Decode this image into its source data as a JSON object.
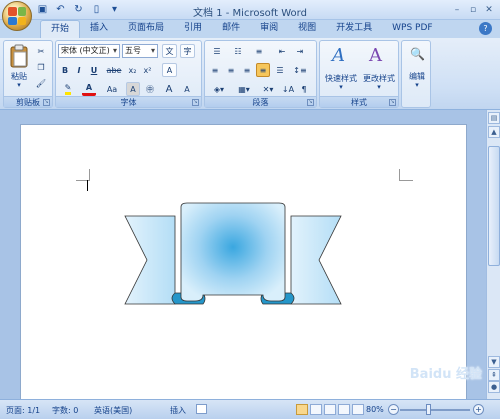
{
  "window": {
    "title": "文档 1 - Microsoft Word"
  },
  "tabs": [
    "开始",
    "插入",
    "页面布局",
    "引用",
    "邮件",
    "审阅",
    "视图",
    "开发工具",
    "WPS PDF"
  ],
  "active_tab": "开始",
  "ribbon": {
    "clipboard": {
      "paste_label": "粘贴",
      "group_label": "剪贴板"
    },
    "font": {
      "font_name": "宋体 (中文正)",
      "font_size": "五号",
      "group_label": "字体",
      "bold": "B",
      "italic": "I",
      "underline": "U",
      "strike": "abe",
      "subscript": "x₂",
      "superscript": "x²",
      "grow": "A",
      "shrink": "A",
      "font_color": "A",
      "change_case": "Aa",
      "char_shading": "A",
      "wen": "文",
      "clear": "A",
      "enclose": "字"
    },
    "paragraph": {
      "group_label": "段落"
    },
    "styles": {
      "quick_styles": "快速样式",
      "change_styles": "更改样式",
      "group_label": "样式"
    },
    "editing": {
      "label": "编辑"
    }
  },
  "statusbar": {
    "page": "页面: 1/1",
    "words": "字数: 0",
    "language": "英语(美国)",
    "insert_mode": "插入",
    "zoom": "80%"
  },
  "watermark": "Baidu 经验",
  "colors": {
    "ribbon_blue": "#dfeaf7",
    "banner_light": "#d2ecfb",
    "banner_mid": "#9fd3f2",
    "banner_dark": "#2596c9"
  }
}
